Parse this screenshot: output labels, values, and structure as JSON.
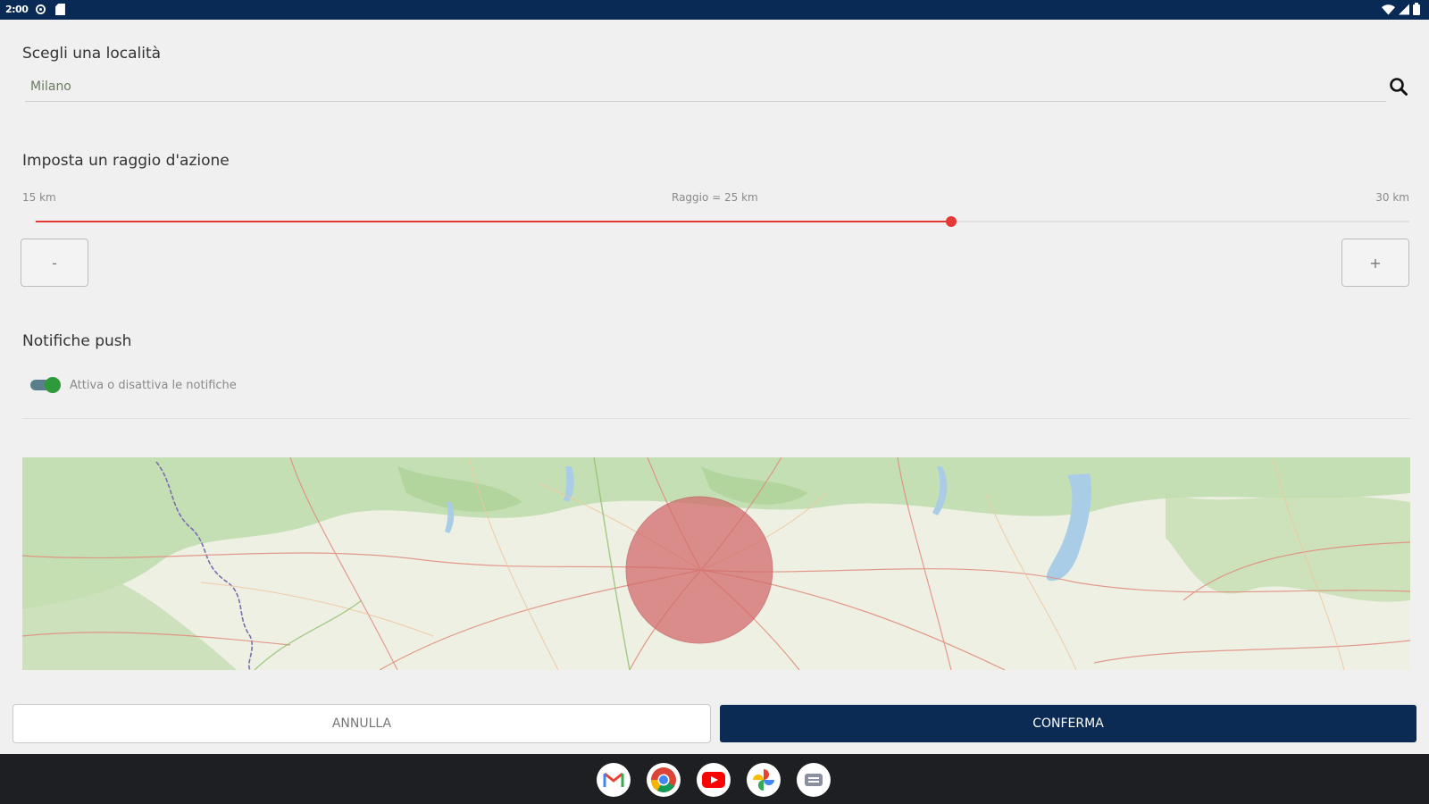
{
  "status_bar": {
    "time": "2:00"
  },
  "location": {
    "title": "Scegli una località",
    "value": "Milano"
  },
  "radius": {
    "title": "Imposta un raggio d'azione",
    "min_label": "15 km",
    "current_label": "Raggio = 25 km",
    "max_label": "30 km",
    "value_km": 25,
    "min_km": 15,
    "max_km": 30,
    "decrement_label": "-",
    "increment_label": "+"
  },
  "notifications": {
    "title": "Notifiche push",
    "toggle_label": "Attiva o disattiva le notifiche",
    "enabled": true
  },
  "map": {
    "circle_color": "#d26b6b",
    "water_color": "#a9cde6",
    "forest_color": "#b7d9a4"
  },
  "actions": {
    "cancel_label": "ANNULLA",
    "confirm_label": "CONFERMA"
  },
  "colors": {
    "header": "#082a54",
    "accent": "#e53935",
    "primary_button": "#0b2a54",
    "toggle_on": "#2f9a3b"
  },
  "dock": {
    "apps": [
      {
        "name": "gmail",
        "icon": "gmail-icon"
      },
      {
        "name": "chrome",
        "icon": "chrome-icon"
      },
      {
        "name": "youtube",
        "icon": "youtube-icon"
      },
      {
        "name": "photos",
        "icon": "photos-icon"
      },
      {
        "name": "messages",
        "icon": "messages-icon"
      }
    ]
  }
}
